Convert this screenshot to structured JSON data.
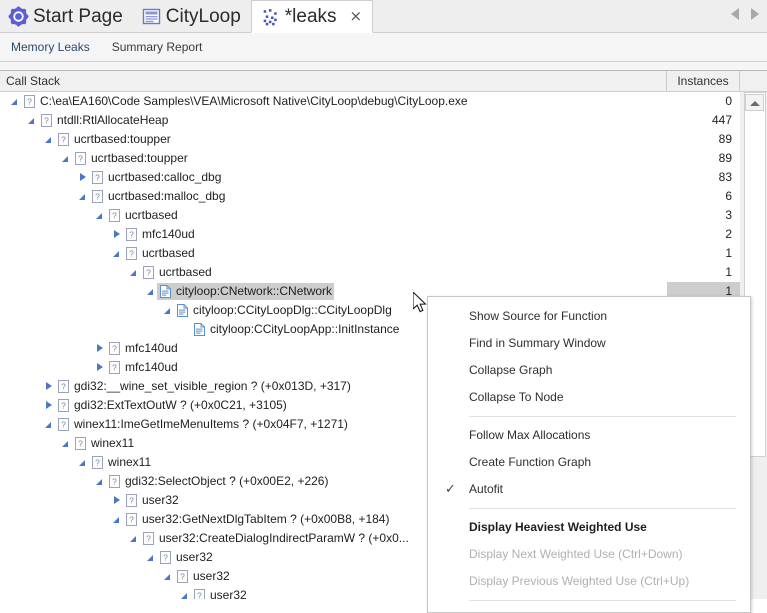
{
  "window": {
    "doc_tabs": [
      {
        "label": "Start Page",
        "icon": "start-page-icon",
        "active": false
      },
      {
        "label": "CityLoop",
        "icon": "document-icon",
        "active": false
      },
      {
        "label": "*leaks",
        "icon": "leaks-scatter-icon",
        "active": true,
        "close_glyph": "×"
      }
    ],
    "tab_nav": {
      "prev": "prev-tab-arrow",
      "next": "next-tab-arrow"
    }
  },
  "subtabs": [
    {
      "label": "Memory Leaks",
      "active": true
    },
    {
      "label": "Summary Report",
      "active": false
    }
  ],
  "grid": {
    "columns": [
      {
        "label": "Call Stack",
        "key": "name"
      },
      {
        "label": "Instances",
        "key": "instances"
      }
    ],
    "rows": [
      {
        "depth": 0,
        "twisty": "expanded",
        "icon": "unknown-module-icon",
        "name": "C:\\ea\\EA160\\Code Samples\\VEA\\Microsoft Native\\CityLoop\\debug\\CityLoop.exe",
        "instances": "0",
        "selected": false
      },
      {
        "depth": 1,
        "twisty": "expanded",
        "icon": "unknown-module-icon",
        "name": "ntdll:RtlAllocateHeap",
        "instances": "447",
        "selected": false
      },
      {
        "depth": 2,
        "twisty": "expanded",
        "icon": "unknown-module-icon",
        "name": "ucrtbased:toupper",
        "instances": "89",
        "selected": false
      },
      {
        "depth": 3,
        "twisty": "expanded",
        "icon": "unknown-module-icon",
        "name": "ucrtbased:toupper",
        "instances": "89",
        "selected": false
      },
      {
        "depth": 4,
        "twisty": "collapsed",
        "icon": "unknown-module-icon",
        "name": "ucrtbased:calloc_dbg",
        "instances": "83",
        "selected": false
      },
      {
        "depth": 4,
        "twisty": "expanded",
        "icon": "unknown-module-icon",
        "name": "ucrtbased:malloc_dbg",
        "instances": "6",
        "selected": false
      },
      {
        "depth": 5,
        "twisty": "expanded",
        "icon": "unknown-module-icon",
        "name": "ucrtbased",
        "instances": "3",
        "selected": false
      },
      {
        "depth": 6,
        "twisty": "collapsed",
        "icon": "unknown-module-icon",
        "name": "mfc140ud",
        "instances": "2",
        "selected": false
      },
      {
        "depth": 6,
        "twisty": "expanded",
        "icon": "unknown-module-icon",
        "name": "ucrtbased",
        "instances": "1",
        "selected": false
      },
      {
        "depth": 7,
        "twisty": "expanded",
        "icon": "unknown-module-icon",
        "name": "ucrtbased",
        "instances": "1",
        "selected": false
      },
      {
        "depth": 8,
        "twisty": "expanded",
        "icon": "source-file-icon",
        "name": "cityloop:CNetwork::CNetwork",
        "instances": "1",
        "selected": true
      },
      {
        "depth": 9,
        "twisty": "expanded",
        "icon": "source-file-icon",
        "name": "cityloop:CCityLoopDlg::CCityLoopDlg",
        "instances": "",
        "selected": false
      },
      {
        "depth": 10,
        "twisty": "none",
        "icon": "source-file-icon",
        "name": "cityloop:CCityLoopApp::InitInstance",
        "instances": "",
        "selected": false
      },
      {
        "depth": 5,
        "twisty": "collapsed",
        "icon": "unknown-module-icon",
        "name": "mfc140ud",
        "instances": "",
        "selected": false
      },
      {
        "depth": 5,
        "twisty": "collapsed",
        "icon": "unknown-module-icon",
        "name": "mfc140ud",
        "instances": "",
        "selected": false
      },
      {
        "depth": 2,
        "twisty": "collapsed",
        "icon": "unknown-module-icon",
        "name": "gdi32:__wine_set_visible_region ? (+0x013D, +317)",
        "instances": "",
        "selected": false
      },
      {
        "depth": 2,
        "twisty": "collapsed",
        "icon": "unknown-module-icon",
        "name": "gdi32:ExtTextOutW ? (+0x0C21, +3105)",
        "instances": "",
        "selected": false
      },
      {
        "depth": 2,
        "twisty": "expanded",
        "icon": "unknown-module-icon",
        "name": "winex11:ImeGetImeMenuItems ? (+0x04F7, +1271)",
        "instances": "",
        "selected": false
      },
      {
        "depth": 3,
        "twisty": "expanded",
        "icon": "unknown-module-icon",
        "name": "winex11",
        "instances": "",
        "selected": false
      },
      {
        "depth": 4,
        "twisty": "expanded",
        "icon": "unknown-module-icon",
        "name": "winex11",
        "instances": "",
        "selected": false
      },
      {
        "depth": 5,
        "twisty": "expanded",
        "icon": "unknown-module-icon",
        "name": "gdi32:SelectObject ? (+0x00E2, +226)",
        "instances": "",
        "selected": false
      },
      {
        "depth": 6,
        "twisty": "collapsed",
        "icon": "unknown-module-icon",
        "name": "user32",
        "instances": "",
        "selected": false
      },
      {
        "depth": 6,
        "twisty": "expanded",
        "icon": "unknown-module-icon",
        "name": "user32:GetNextDlgTabItem ? (+0x00B8, +184)",
        "instances": "",
        "selected": false
      },
      {
        "depth": 7,
        "twisty": "expanded",
        "icon": "unknown-module-icon",
        "name": "user32:CreateDialogIndirectParamW ? (+0x0...",
        "instances": "",
        "selected": false
      },
      {
        "depth": 8,
        "twisty": "expanded",
        "icon": "unknown-module-icon",
        "name": "user32",
        "instances": "",
        "selected": false
      },
      {
        "depth": 9,
        "twisty": "expanded",
        "icon": "unknown-module-icon",
        "name": "user32",
        "instances": "",
        "selected": false
      },
      {
        "depth": 10,
        "twisty": "expanded",
        "icon": "unknown-module-icon",
        "name": "user32",
        "instances": "",
        "selected": false
      }
    ]
  },
  "scrollbar": {
    "up_arrow": "scroll-up-arrow"
  },
  "context_menu": {
    "items": [
      {
        "type": "item",
        "label": "Show Source for Function",
        "checked": false,
        "disabled": false,
        "bold": false
      },
      {
        "type": "item",
        "label": "Find in Summary Window",
        "checked": false,
        "disabled": false,
        "bold": false
      },
      {
        "type": "item",
        "label": "Collapse Graph",
        "checked": false,
        "disabled": false,
        "bold": false
      },
      {
        "type": "item",
        "label": "Collapse To Node",
        "checked": false,
        "disabled": false,
        "bold": false
      },
      {
        "type": "separator"
      },
      {
        "type": "item",
        "label": "Follow Max Allocations",
        "checked": false,
        "disabled": false,
        "bold": false
      },
      {
        "type": "item",
        "label": "Create Function Graph",
        "checked": false,
        "disabled": false,
        "bold": false
      },
      {
        "type": "item",
        "label": "Autofit",
        "checked": true,
        "check_glyph": "✓",
        "disabled": false,
        "bold": false
      },
      {
        "type": "separator"
      },
      {
        "type": "item",
        "label": "Display Heaviest Weighted Use",
        "checked": false,
        "disabled": false,
        "bold": true
      },
      {
        "type": "item",
        "label": "Display Next Weighted Use (Ctrl+Down)",
        "checked": false,
        "disabled": true,
        "bold": false
      },
      {
        "type": "item",
        "label": "Display Previous Weighted Use (Ctrl+Up)",
        "checked": false,
        "disabled": true,
        "bold": false
      },
      {
        "type": "separator"
      }
    ]
  },
  "cursor": {
    "name": "mouse-pointer"
  }
}
